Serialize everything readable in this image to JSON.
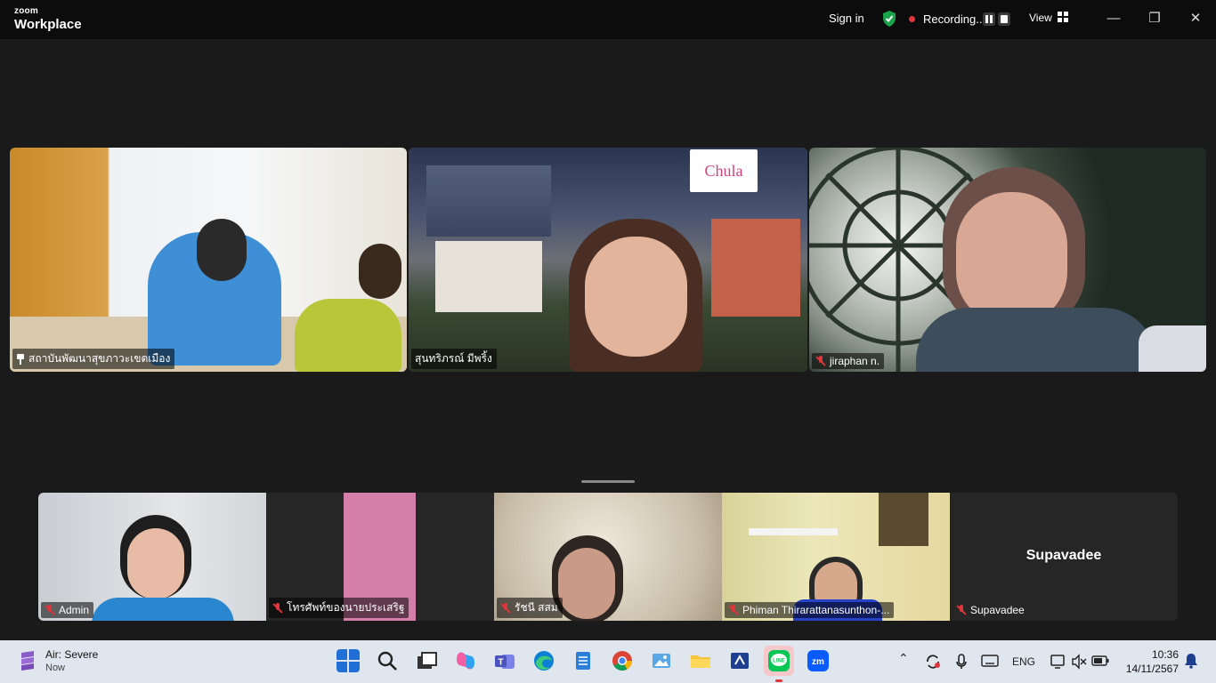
{
  "app": {
    "brand_small": "zoom",
    "brand_name": "Workplace"
  },
  "header": {
    "sign_in": "Sign in",
    "recording_label": "Recording...",
    "view_label": "View"
  },
  "participants_top": [
    {
      "name": "สถาบันพัฒนาสุขภาวะเขตเมือง",
      "icon": "pin-icon"
    },
    {
      "name": "สุนทริภรณ์ มีพริ้ง",
      "icon": "none",
      "active_speaker": true,
      "badge": "Chula"
    },
    {
      "name": "jiraphan n.",
      "icon": "mic-off-icon"
    }
  ],
  "participants_bottom": [
    {
      "name": "Admin",
      "icon": "mic-off-icon"
    },
    {
      "name": "โทรศัพท์ของนายประเสริฐ",
      "icon": "mic-off-icon"
    },
    {
      "name": "รัชนี สสม",
      "icon": "mic-off-icon"
    },
    {
      "name": "Phiman Thirarattanasunthon-...",
      "icon": "mic-off-icon"
    },
    {
      "name": "Supavadee",
      "icon": "mic-off-icon",
      "center_label": "Supavadee"
    }
  ],
  "taskbar": {
    "weather_title": "Air: Severe",
    "weather_sub": "Now",
    "language": "ENG",
    "time": "10:36",
    "date": "14/11/2567",
    "apps": [
      "start-icon",
      "search-icon",
      "task-view-icon",
      "copilot-icon",
      "teams-icon",
      "edge-icon",
      "notepad-icon",
      "chrome-icon",
      "photos-icon",
      "file-explorer-icon",
      "snipping-tool-icon",
      "line-icon",
      "zoom-icon"
    ]
  },
  "colors": {
    "active_speaker": "#23c55e",
    "mic_off": "#e0353a",
    "titlebar": "#0c0c0c",
    "stage": "#1a1a1a",
    "taskbar": "#dfe6ee"
  }
}
